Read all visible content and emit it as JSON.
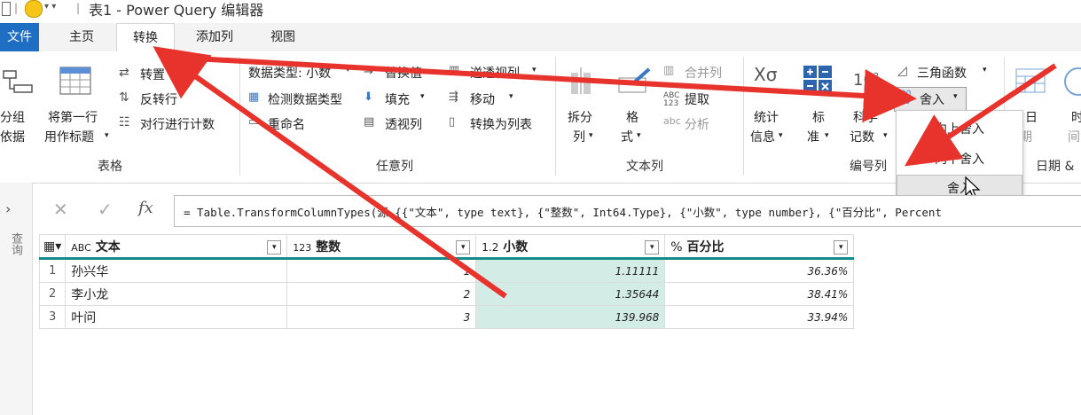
{
  "window": {
    "title": "表1 - Power Query 编辑器"
  },
  "tabs": [
    {
      "label": "文件"
    },
    {
      "label": "主页"
    },
    {
      "label": "转换"
    },
    {
      "label": "添加列"
    },
    {
      "label": "视图"
    }
  ],
  "ribbon": {
    "table_group": {
      "name": "表格",
      "group_by_l1": "分组",
      "group_by_l2": "依据",
      "use_first_row_l1": "将第一行",
      "use_first_row_l2": "用作标题",
      "transpose": "转置",
      "reverse_rows": "反转行",
      "count_rows": "对行进行计数"
    },
    "any_column_group": {
      "name": "任意列",
      "data_type": "数据类型: 小数",
      "detect_type": "检测数据类型",
      "rename": "重命名",
      "replace_values": "替换值",
      "fill": "填充",
      "pivot": "透视列",
      "unpivot": "逆透视列",
      "move": "移动",
      "to_list": "转换为列表"
    },
    "text_column_group": {
      "name": "文本列",
      "split_l1": "拆分",
      "split_l2": "列",
      "format_l1": "格",
      "format_l2": "式",
      "merge": "合并列",
      "extract": "提取",
      "parse": "分析"
    },
    "number_column_group": {
      "name": "编号列",
      "stats_l1": "统计",
      "stats_l2": "信息",
      "standard_l1": "标",
      "standard_l2": "准",
      "scientific_l1": "科学",
      "scientific_l2": "记数",
      "trig": "三角函数",
      "rounding": "舍入"
    },
    "datetime_group": {
      "name": "日期 &",
      "date_l1": "日",
      "date_l2": "期",
      "time_l1": "时",
      "time_l2": "间"
    }
  },
  "rounding_menu": [
    {
      "label": "向上舍入"
    },
    {
      "label": "向下舍入"
    },
    {
      "label": "舍入"
    }
  ],
  "formula_bar": {
    "fx": "fx",
    "formula": "= Table.TransformColumnTypes(源,{{\"文本\", type text}, {\"整数\", Int64.Type}, {\"小数\", type number}, {\"百分比\", Percent"
  },
  "query_pane_label": "查询",
  "grid": {
    "columns": [
      {
        "type_icon": "ABC",
        "name": "文本"
      },
      {
        "type_icon": "123",
        "name": "整数"
      },
      {
        "type_icon": "1.2",
        "name": "小数"
      },
      {
        "type_icon": "%",
        "name": "百分比"
      }
    ],
    "rows": [
      {
        "n": "1",
        "c1": "孙兴华",
        "c2": "1",
        "c3": "1.11111",
        "c4": "36.36%"
      },
      {
        "n": "2",
        "c1": "李小龙",
        "c2": "2",
        "c3": "1.35644",
        "c4": "38.41%"
      },
      {
        "n": "3",
        "c1": "叶问",
        "c2": "3",
        "c3": "139.968",
        "c4": "33.94%"
      }
    ]
  },
  "colors": {
    "accent": "#1e6fc4",
    "annotation": "#e8322c",
    "selected_column": "#d4ece6",
    "header_rule": "#148a8a"
  }
}
